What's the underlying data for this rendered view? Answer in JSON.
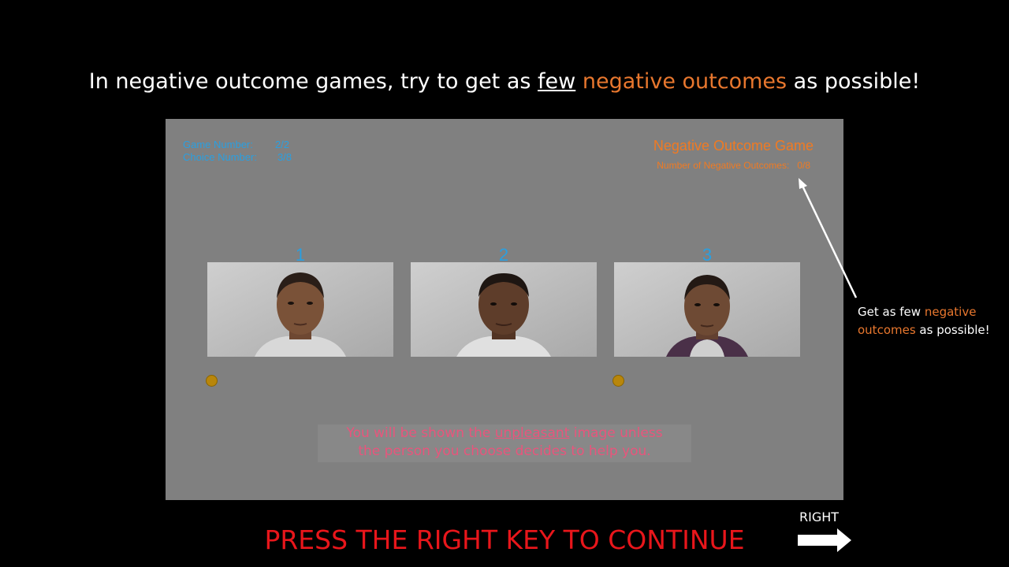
{
  "headline": {
    "part1": "In negative outcome games, try to get as ",
    "few": "few",
    "neg": "negative outcomes",
    "part2": " as possible!"
  },
  "game": {
    "game_number_label": "Game Number:",
    "game_number_value": "2/2",
    "choice_number_label": "Choice Number:",
    "choice_number_value": "3/8",
    "title": "Negative Outcome Game",
    "neg_outcomes_label": "Number of Negative Outcomes:",
    "neg_outcomes_value": "0/8"
  },
  "faces": [
    {
      "number": "1",
      "skin": "#7a5238",
      "hair": "#2a1e18",
      "shirt": "#d8d8d8",
      "smiley": true
    },
    {
      "number": "2",
      "skin": "#5e3d2a",
      "hair": "#1e1612",
      "shirt": "#e0e0e0",
      "smiley": false
    },
    {
      "number": "3",
      "skin": "#6e4a34",
      "hair": "#231914",
      "shirt": "#4a3048",
      "smiley": true
    }
  ],
  "notice": {
    "line1_pre": "You will be shown the ",
    "line1_u": "unpleasant",
    "line1_post": " image unless",
    "line2": "the person you choose decides to help you."
  },
  "callout": {
    "pre": "Get as few ",
    "neg1": "negative",
    "neg2": "outcomes",
    "post": " as possible!"
  },
  "footer": {
    "press": "PRESS THE RIGHT KEY TO CONTINUE",
    "right_label": "RIGHT"
  }
}
